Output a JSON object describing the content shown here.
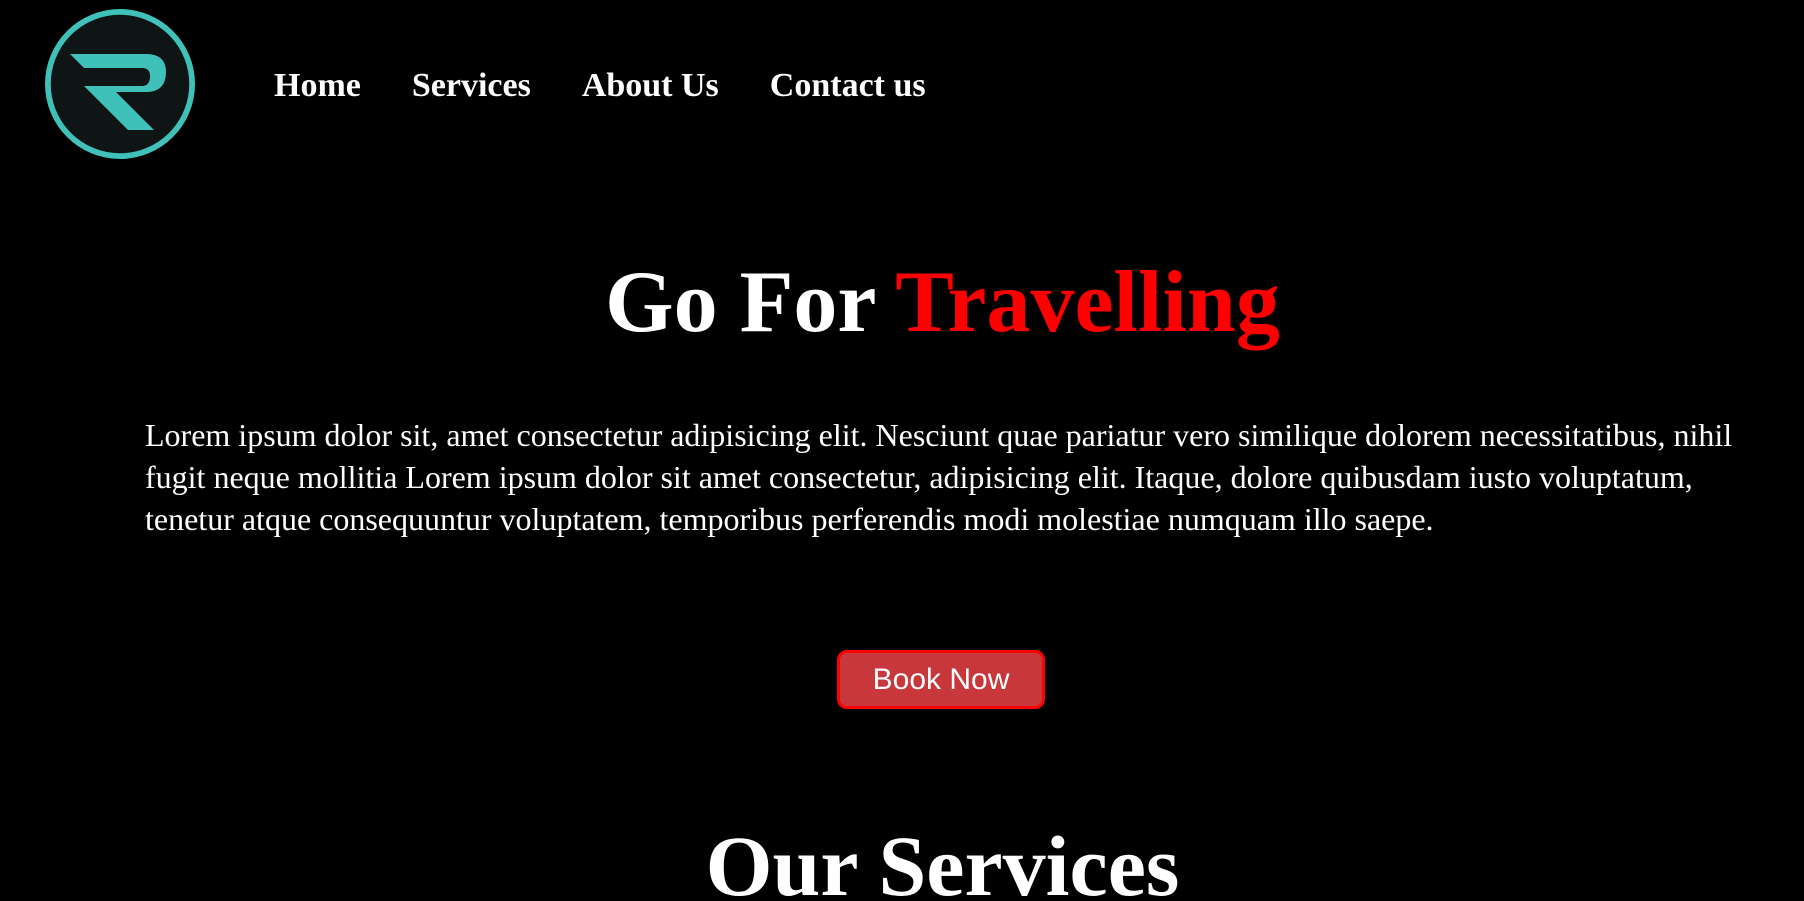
{
  "header": {
    "logo_icon": "r-monogram-logo-icon",
    "nav": [
      {
        "label": "Home"
      },
      {
        "label": "Services"
      },
      {
        "label": "About Us"
      },
      {
        "label": "Contact us"
      }
    ]
  },
  "hero": {
    "title_main": "Go For",
    "title_accent": "Travelling",
    "paragraph": "Lorem ipsum dolor sit, amet consectetur adipisicing elit. Nesciunt quae pariatur vero similique dolorem necessitatibus, nihil fugit neque mollitia Lorem ipsum dolor sit amet consectetur, adipisicing elit. Itaque, dolore quibusdam iusto voluptatum, tenetur atque consequuntur voluptatem, temporibus perferendis modi molestiae numquam illo saepe.",
    "cta_label": "Book Now"
  },
  "services": {
    "heading": "Our Services"
  },
  "colors": {
    "background": "#000000",
    "text": "#ffffff",
    "accent": "#ff0000",
    "button_bg": "#c8373c",
    "logo_teal": "#3fc1b9",
    "logo_dark": "#0f1414"
  }
}
